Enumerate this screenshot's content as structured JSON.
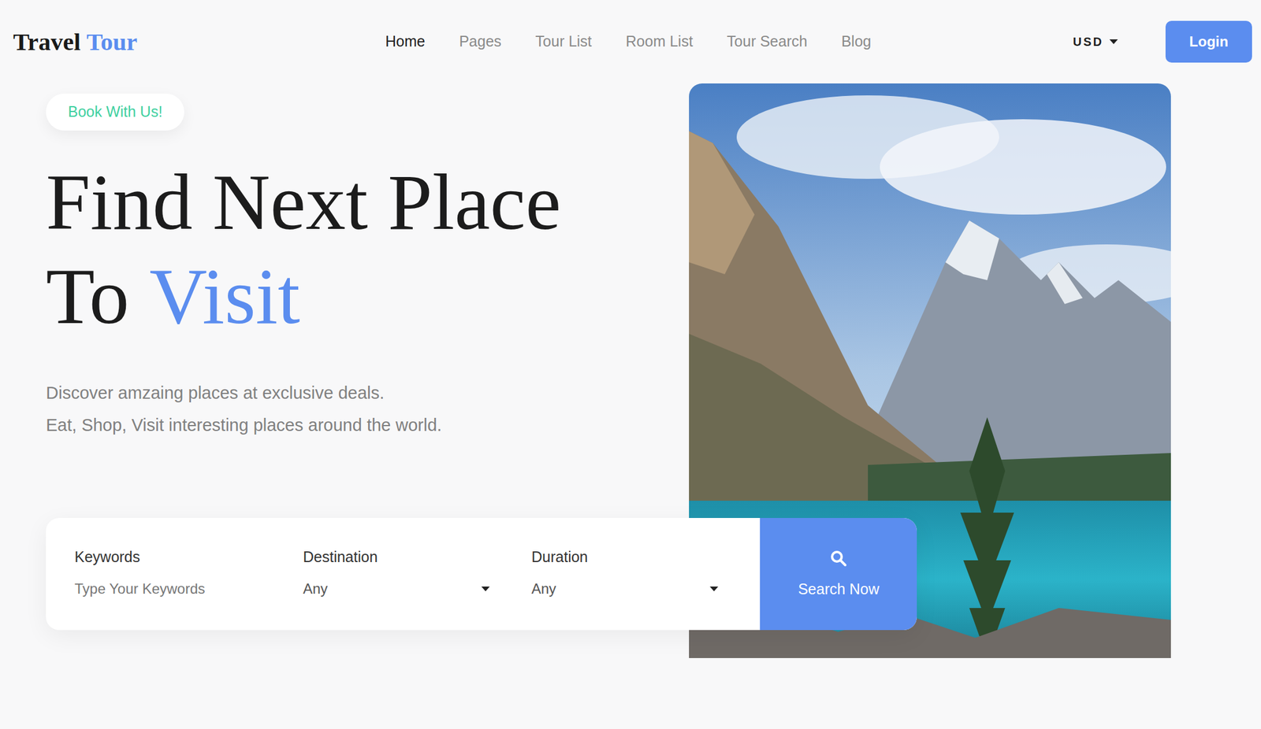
{
  "logo": {
    "first": "Travel",
    "second": "Tour"
  },
  "nav": [
    {
      "label": "Home",
      "selected": true
    },
    {
      "label": "Pages",
      "selected": false
    },
    {
      "label": "Tour List",
      "selected": false
    },
    {
      "label": "Room List",
      "selected": false
    },
    {
      "label": "Tour Search",
      "selected": false
    },
    {
      "label": "Blog",
      "selected": false
    }
  ],
  "currency": "USD",
  "login": "Login",
  "hero": {
    "badge": "Book With Us!",
    "title_line1": "Find Next Place",
    "title_line2_plain": "To",
    "title_line2_accent": "Visit",
    "subtitle": [
      "Discover amzaing places at exclusive deals.",
      "Eat, Shop, Visit interesting places around the world."
    ]
  },
  "search": {
    "fields": [
      {
        "label": "Keywords",
        "kind": "input",
        "placeholder": "Type Your Keywords"
      },
      {
        "label": "Destination",
        "kind": "select",
        "value": "Any"
      },
      {
        "label": "Duration",
        "kind": "select",
        "value": "Any"
      }
    ],
    "button": "Search Now"
  }
}
